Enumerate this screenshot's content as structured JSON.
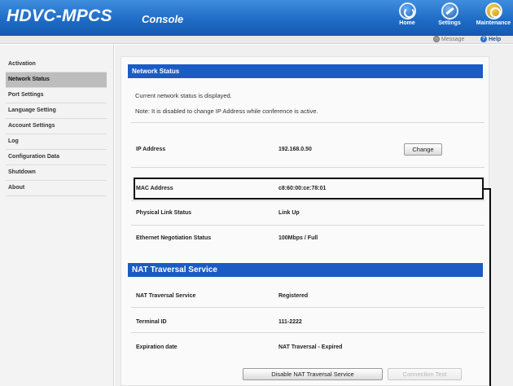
{
  "header": {
    "brand": "HDVC-MPCS",
    "subtitle": "Console",
    "nav": [
      {
        "label": "Home",
        "icon": "home-icon"
      },
      {
        "label": "Settings",
        "icon": "settings-icon"
      },
      {
        "label": "Maintenance",
        "icon": "maintenance-icon"
      }
    ],
    "message_label": "Message",
    "help_label": "Help"
  },
  "sidebar": {
    "items": [
      {
        "label": "Activation"
      },
      {
        "label": "Network Status"
      },
      {
        "label": "Port Settings"
      },
      {
        "label": "Language Setting"
      },
      {
        "label": "Account Settings"
      },
      {
        "label": "Log"
      },
      {
        "label": "Configuration Data"
      },
      {
        "label": "Shutdown"
      },
      {
        "label": "About"
      }
    ],
    "active_index": 1
  },
  "network": {
    "section_title": "Network Status",
    "note1": "Current network status is displayed.",
    "note2": "Note: It is disabled to change IP Address while conference is active.",
    "ip_label": "IP Address",
    "ip_value": "192.168.0.50",
    "change_button": "Change",
    "mac_label": "MAC Address",
    "mac_value": "c8:60:00:ce:78:01",
    "link_label": "Physical Link Status",
    "link_value": "Link Up",
    "eth_label": "Ethernet Negotiation Status",
    "eth_value": "100Mbps / Full"
  },
  "nat": {
    "section_title": "NAT Traversal Service",
    "service_label": "NAT Traversal Service",
    "service_value": "Registered",
    "terminal_label": "Terminal ID",
    "terminal_value": "111-2222",
    "expiration_label": "Expiration date",
    "expiration_value": "NAT Traversal - Expired",
    "disable_button": "Disable NAT Traversal Service",
    "test_button": "Connection Test"
  },
  "colors": {
    "header_blue": "#1f6cc6",
    "section_blue": "#1a5bc4",
    "active_sidebar": "#bdbdbd"
  }
}
